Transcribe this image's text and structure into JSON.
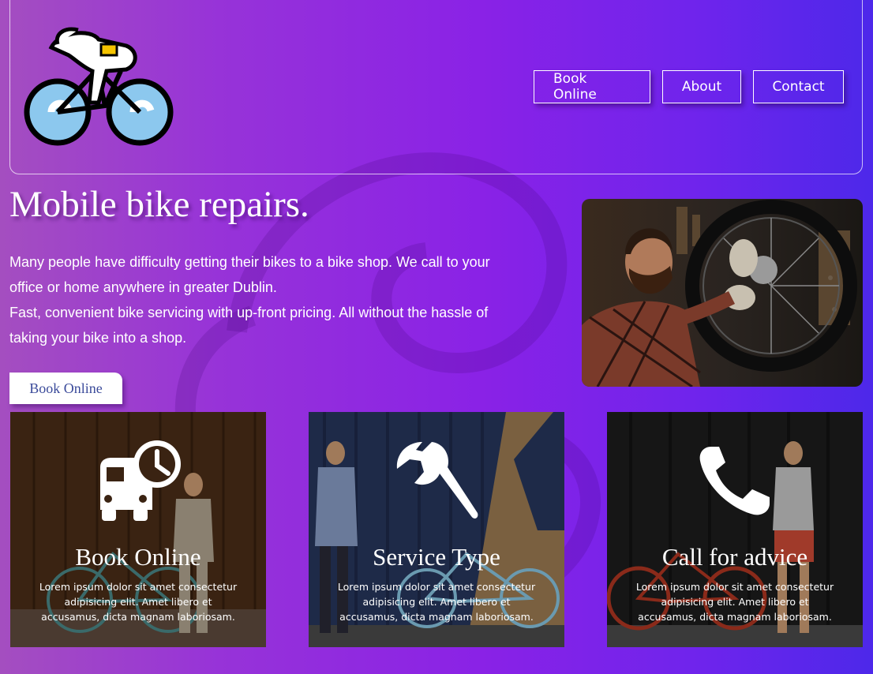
{
  "header": {
    "logo_alt": "cyclist-logo",
    "nav": [
      {
        "label": "Book Online"
      },
      {
        "label": "About"
      },
      {
        "label": "Contact"
      }
    ]
  },
  "hero": {
    "title": "Mobile bike repairs.",
    "paragraph_1": "Many people have difficulty getting their bikes to a bike shop. We call to your office or home anywhere in greater Dublin.",
    "paragraph_2": "Fast, convenient bike servicing with up-front pricing. All without the hassle of taking your bike into a shop.",
    "cta_label": "Book Online",
    "photo": "mechanic-repairing-bike-wheel"
  },
  "cards": [
    {
      "title": "Book Online",
      "text": "Lorem ipsum dolor sit amet consectetur adipisicing elit. Amet libero et accusamus, dicta magnam laboriosam.",
      "icon": "bus-clock-icon"
    },
    {
      "title": "Service Type",
      "text": "Lorem ipsum dolor sit amet consectetur adipisicing elit. Amet libero et accusamus, dicta magnam laboriosam.",
      "icon": "wrench-icon"
    },
    {
      "title": "Call for advice",
      "text": "Lorem ipsum dolor sit amet consectetur adipisicing elit. Amet libero et accusamus, dicta magnam laboriosam.",
      "icon": "phone-icon"
    }
  ],
  "colors": {
    "gradient_left": "#a44ec0",
    "gradient_mid": "#8a22e6",
    "gradient_right": "#4d28ea",
    "cta_text": "#3a4a9a"
  }
}
